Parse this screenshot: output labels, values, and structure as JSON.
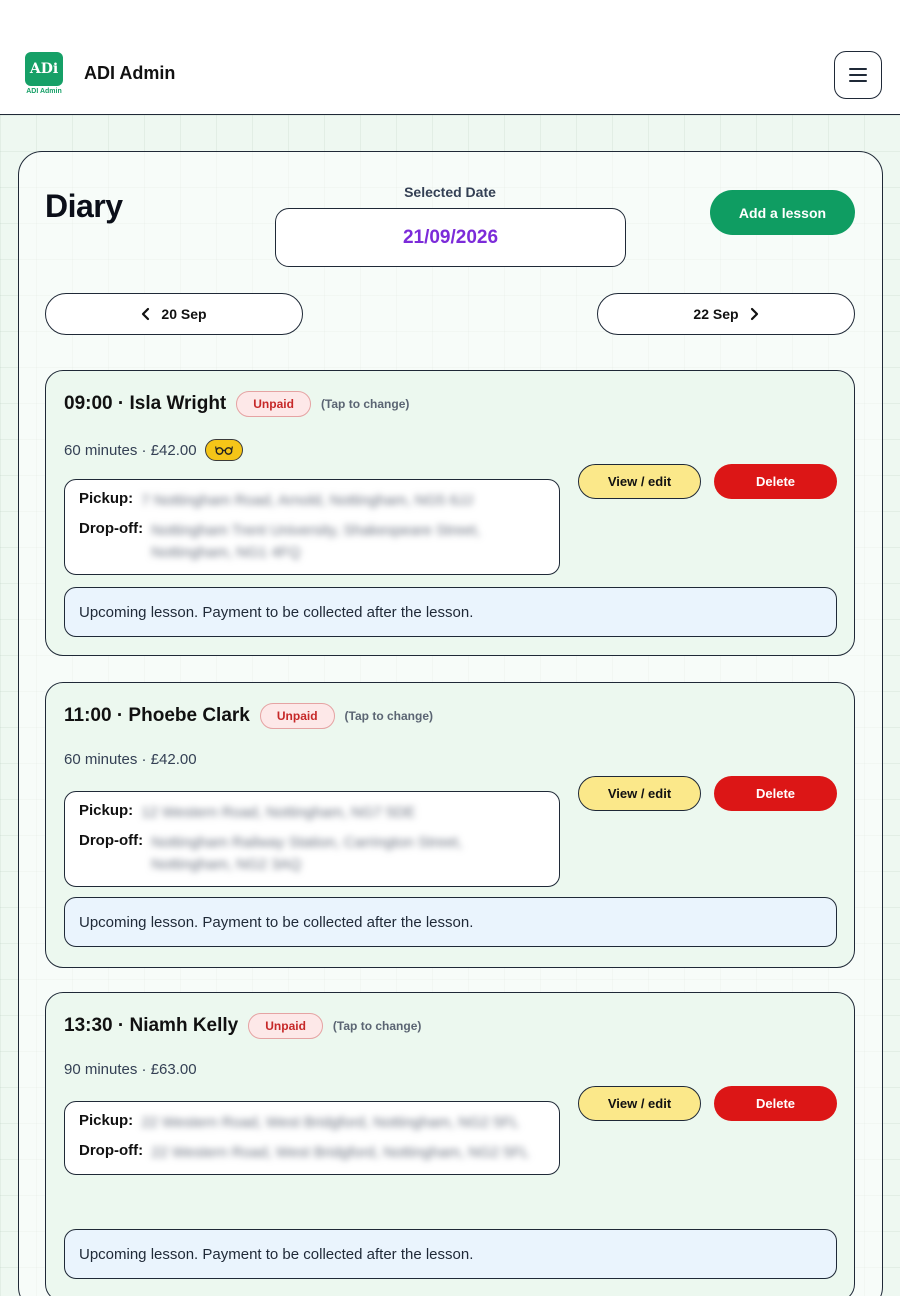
{
  "app": {
    "logo_text": "ADi",
    "logo_caption": "ADI Admin",
    "title": "ADI Admin"
  },
  "diary": {
    "title": "Diary",
    "selected_date_label": "Selected Date",
    "selected_date": "21/09/2026",
    "add_lesson_label": "Add a lesson",
    "prev_day_label": "20 Sep",
    "next_day_label": "22 Sep"
  },
  "lessons": [
    {
      "title": "09:00 · Isla Wright",
      "payment_status": "Unpaid",
      "tap_hint": "(Tap to change)",
      "meta": "60 minutes · £42.00",
      "has_glasses_badge": true,
      "pickup_label": "Pickup:",
      "pickup": "7 Nottingham Road, Arnold, Nottingham, NG5 6JJ",
      "dropoff_label": "Drop-off:",
      "dropoff": "Nottingham Trent University, Shakespeare Street, Nottingham, NG1 4FQ",
      "view_label": "View / edit",
      "delete_label": "Delete",
      "status": "Upcoming lesson. Payment to be collected after the lesson."
    },
    {
      "title": "11:00 · Phoebe Clark",
      "payment_status": "Unpaid",
      "tap_hint": "(Tap to change)",
      "meta": "60 minutes · £42.00",
      "has_glasses_badge": false,
      "pickup_label": "Pickup:",
      "pickup": "12 Western Road, Nottingham, NG7 5DE",
      "dropoff_label": "Drop-off:",
      "dropoff": "Nottingham Railway Station, Carrington Street, Nottingham, NG2 3AQ",
      "view_label": "View / edit",
      "delete_label": "Delete",
      "status": "Upcoming lesson. Payment to be collected after the lesson."
    },
    {
      "title": "13:30 · Niamh Kelly",
      "payment_status": "Unpaid",
      "tap_hint": "(Tap to change)",
      "meta": "90 minutes · £63.00",
      "has_glasses_badge": false,
      "pickup_label": "Pickup:",
      "pickup": "22 Western Road, West Bridgford, Nottingham, NG2 5FL",
      "dropoff_label": "Drop-off:",
      "dropoff": "22 Western Road, West Bridgford, Nottingham, NG2 5FL",
      "view_label": "View / edit",
      "delete_label": "Delete",
      "status": "Upcoming lesson. Payment to be collected after the lesson."
    }
  ],
  "colors": {
    "brand_green": "#0f9d62",
    "date_purple": "#7c2bd9",
    "delete_red": "#dc1616",
    "view_yellow": "#fbe88a"
  },
  "icons": {
    "menu": "hamburger-icon",
    "prev": "chevron-left-icon",
    "next": "chevron-right-icon",
    "glasses": "glasses-icon"
  }
}
